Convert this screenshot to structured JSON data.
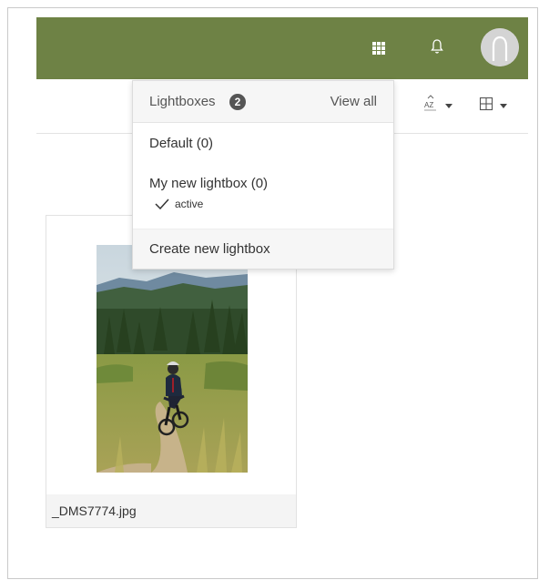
{
  "topbar": {
    "bg_color": "#6e8245",
    "icons": [
      "apps-grid-icon",
      "bell-icon",
      "avatar-icon"
    ]
  },
  "toolbar": {
    "sort_icon_label": "AZ",
    "icons": [
      "sort-az-icon",
      "grid-view-icon"
    ]
  },
  "lightbox_menu": {
    "title": "Lightboxes",
    "count": "2",
    "view_all": "View all",
    "items": [
      {
        "label": "Default (0)"
      },
      {
        "label": "My new lightbox (0)",
        "status": "active"
      }
    ],
    "create_label": "Create new lightbox"
  },
  "asset": {
    "filename": "_DMS7774.jpg"
  }
}
